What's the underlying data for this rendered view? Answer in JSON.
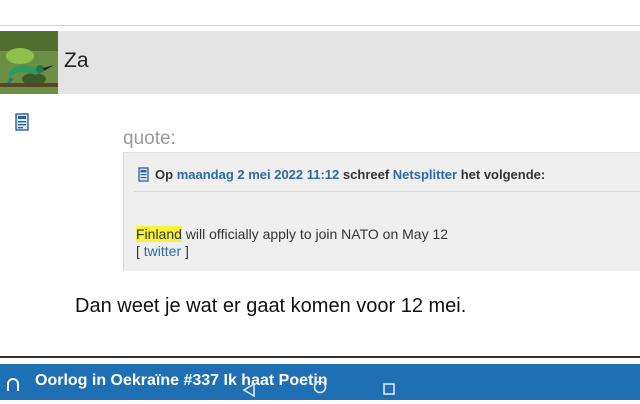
{
  "user": {
    "name": "Za"
  },
  "quote": {
    "label": "quote:",
    "prefix": "Op",
    "date": "maandag 2 mei 2022 11:12",
    "wrote": "schreef",
    "author": "Netsplitter",
    "suffix": "het volgende:",
    "highlight": "Finland",
    "text": " will officially apply to join NATO on May 12",
    "link_open": "[ ",
    "link_text": "twitter",
    "link_close": " ]"
  },
  "post": {
    "body": "Dan weet je wat er gaat komen voor 12 mei."
  },
  "topic": {
    "title": "Oorlog in Oekraïne #337 Ik haat Poetin"
  },
  "colors": {
    "accent": "#1f6fb5",
    "link": "#2e6aa0",
    "highlight": "#f7f23b",
    "user_bar": "#e4e4e4",
    "quote_bg": "#efefef"
  },
  "icons": {
    "post": "post-document-icon",
    "quote": "quote-document-icon",
    "topic": "topic-icon",
    "nav_back": "back-icon",
    "nav_home": "home-icon",
    "nav_recent": "recent-apps-icon"
  }
}
